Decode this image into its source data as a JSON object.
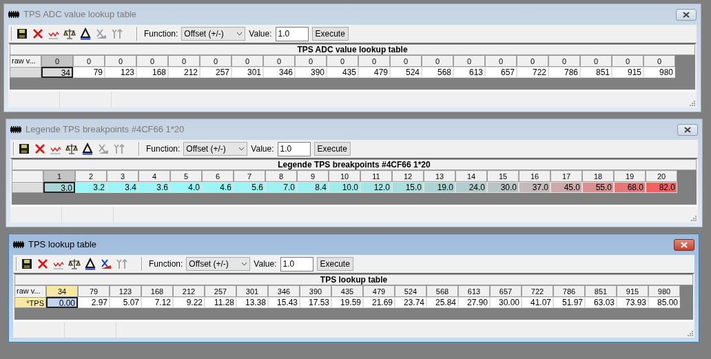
{
  "windows": [
    {
      "title": "TPS ADC value lookup table",
      "active": false,
      "toolbar": {
        "icons": [
          {
            "kind": "save",
            "disabled": false
          },
          {
            "kind": "delete",
            "disabled": false
          },
          {
            "kind": "graph",
            "disabled": false
          },
          {
            "kind": "scale",
            "disabled": false
          },
          {
            "kind": "delta",
            "disabled": false
          },
          {
            "kind": "x-axis",
            "disabled": true
          },
          {
            "kind": "y-axis",
            "disabled": true
          }
        ],
        "function_label": "Function:",
        "function": "Offset (+/-)",
        "value_label": "Value:",
        "value": "1.0",
        "execute": "Execute"
      },
      "table": {
        "title": "TPS ADC value lookup table",
        "corner": "raw v...",
        "columns": [
          {
            "label": "0",
            "selected": true
          },
          {
            "label": "0",
            "selected": false
          },
          {
            "label": "0",
            "selected": false
          },
          {
            "label": "0",
            "selected": false
          },
          {
            "label": "0",
            "selected": false
          },
          {
            "label": "0",
            "selected": false
          },
          {
            "label": "0",
            "selected": false
          },
          {
            "label": "0",
            "selected": false
          },
          {
            "label": "0",
            "selected": false
          },
          {
            "label": "0",
            "selected": false
          },
          {
            "label": "0",
            "selected": false
          },
          {
            "label": "0",
            "selected": false
          },
          {
            "label": "0",
            "selected": false
          },
          {
            "label": "0",
            "selected": false
          },
          {
            "label": "0",
            "selected": false
          },
          {
            "label": "0",
            "selected": false
          },
          {
            "label": "0",
            "selected": false
          },
          {
            "label": "0",
            "selected": false
          },
          {
            "label": "0",
            "selected": false
          },
          {
            "label": "0",
            "selected": false
          }
        ],
        "cells": [
          {
            "value": "34",
            "selected": true
          },
          {
            "value": "79",
            "selected": false
          },
          {
            "value": "123",
            "selected": false
          },
          {
            "value": "168",
            "selected": false
          },
          {
            "value": "212",
            "selected": false
          },
          {
            "value": "257",
            "selected": false
          },
          {
            "value": "301",
            "selected": false
          },
          {
            "value": "346",
            "selected": false
          },
          {
            "value": "390",
            "selected": false
          },
          {
            "value": "435",
            "selected": false
          },
          {
            "value": "479",
            "selected": false
          },
          {
            "value": "524",
            "selected": false
          },
          {
            "value": "568",
            "selected": false
          },
          {
            "value": "613",
            "selected": false
          },
          {
            "value": "657",
            "selected": false
          },
          {
            "value": "722",
            "selected": false
          },
          {
            "value": "786",
            "selected": false
          },
          {
            "value": "851",
            "selected": false
          },
          {
            "value": "915",
            "selected": false
          },
          {
            "value": "980",
            "selected": false
          }
        ]
      }
    },
    {
      "title": "Legende TPS breakpoints #4CF66 1*20",
      "active": false,
      "toolbar": {
        "icons": [
          {
            "kind": "save",
            "disabled": false
          },
          {
            "kind": "delete",
            "disabled": false
          },
          {
            "kind": "graph",
            "disabled": false
          },
          {
            "kind": "scale",
            "disabled": false
          },
          {
            "kind": "delta",
            "disabled": false
          },
          {
            "kind": "x-axis",
            "disabled": true
          },
          {
            "kind": "y-axis",
            "disabled": true
          }
        ],
        "function_label": "Function:",
        "function": "Offset (+/-)",
        "value_label": "Value:",
        "value": "1.0",
        "execute": "Execute"
      },
      "table": {
        "title": "Legende TPS breakpoints #4CF66 1*20",
        "columns": [
          {
            "label": "1",
            "selected": true
          },
          {
            "label": "2",
            "selected": false
          },
          {
            "label": "3",
            "selected": false
          },
          {
            "label": "4",
            "selected": false
          },
          {
            "label": "5",
            "selected": false
          },
          {
            "label": "6",
            "selected": false
          },
          {
            "label": "7",
            "selected": false
          },
          {
            "label": "8",
            "selected": false
          },
          {
            "label": "9",
            "selected": false
          },
          {
            "label": "10",
            "selected": false
          },
          {
            "label": "11",
            "selected": false
          },
          {
            "label": "12",
            "selected": false
          },
          {
            "label": "13",
            "selected": false
          },
          {
            "label": "14",
            "selected": false
          },
          {
            "label": "15",
            "selected": false
          },
          {
            "label": "16",
            "selected": false
          },
          {
            "label": "17",
            "selected": false
          },
          {
            "label": "18",
            "selected": false
          },
          {
            "label": "19",
            "selected": false
          },
          {
            "label": "20",
            "selected": false
          }
        ],
        "cells": [
          {
            "value": "3.0",
            "selected": true,
            "color": "#a8d6d6"
          },
          {
            "value": "3.2",
            "selected": false,
            "color": "#9af6f6"
          },
          {
            "value": "3.4",
            "selected": false,
            "color": "#9af6f6"
          },
          {
            "value": "3.6",
            "selected": false,
            "color": "#9af6f6"
          },
          {
            "value": "4.0",
            "selected": false,
            "color": "#9af6f6"
          },
          {
            "value": "4.6",
            "selected": false,
            "color": "#9af6f6"
          },
          {
            "value": "5.6",
            "selected": false,
            "color": "#9cf4f4"
          },
          {
            "value": "7.0",
            "selected": false,
            "color": "#9cf2f2"
          },
          {
            "value": "8.4",
            "selected": false,
            "color": "#9ef0f0"
          },
          {
            "value": "10.0",
            "selected": false,
            "color": "#a0ecec"
          },
          {
            "value": "12.0",
            "selected": false,
            "color": "#a4e6e6"
          },
          {
            "value": "15.0",
            "selected": false,
            "color": "#a8e0e0"
          },
          {
            "value": "19.0",
            "selected": false,
            "color": "#aad4d4"
          },
          {
            "value": "24.0",
            "selected": false,
            "color": "#b0cccc"
          },
          {
            "value": "30.0",
            "selected": false,
            "color": "#b8c4c4"
          },
          {
            "value": "37.0",
            "selected": false,
            "color": "#c4b8b8"
          },
          {
            "value": "45.0",
            "selected": false,
            "color": "#cca8a8"
          },
          {
            "value": "55.0",
            "selected": false,
            "color": "#d89090"
          },
          {
            "value": "68.0",
            "selected": false,
            "color": "#e47878"
          },
          {
            "value": "82.0",
            "selected": false,
            "color": "#f26262"
          }
        ]
      }
    },
    {
      "title": "TPS lookup table",
      "active": true,
      "toolbar": {
        "icons": [
          {
            "kind": "save",
            "disabled": false
          },
          {
            "kind": "delete",
            "disabled": false
          },
          {
            "kind": "graph",
            "disabled": false
          },
          {
            "kind": "scale",
            "disabled": false
          },
          {
            "kind": "delta",
            "disabled": false
          },
          {
            "kind": "x-axis",
            "disabled": false
          },
          {
            "kind": "y-axis",
            "disabled": true
          }
        ],
        "function_label": "Function:",
        "function": "Offset (+/-)",
        "value_label": "Value:",
        "value": "1.0",
        "execute": "Execute"
      },
      "table": {
        "title": "TPS lookup table",
        "corner": "raw v...",
        "row_header": "°TPS",
        "row_selected": true,
        "columns": [
          {
            "label": "34",
            "selected": true
          },
          {
            "label": "79",
            "selected": false
          },
          {
            "label": "123",
            "selected": false
          },
          {
            "label": "168",
            "selected": false
          },
          {
            "label": "212",
            "selected": false
          },
          {
            "label": "257",
            "selected": false
          },
          {
            "label": "301",
            "selected": false
          },
          {
            "label": "346",
            "selected": false
          },
          {
            "label": "390",
            "selected": false
          },
          {
            "label": "435",
            "selected": false
          },
          {
            "label": "479",
            "selected": false
          },
          {
            "label": "524",
            "selected": false
          },
          {
            "label": "568",
            "selected": false
          },
          {
            "label": "613",
            "selected": false
          },
          {
            "label": "657",
            "selected": false
          },
          {
            "label": "722",
            "selected": false
          },
          {
            "label": "786",
            "selected": false
          },
          {
            "label": "851",
            "selected": false
          },
          {
            "label": "915",
            "selected": false
          },
          {
            "label": "980",
            "selected": false
          }
        ],
        "cells": [
          {
            "value": "0.00",
            "selected": true
          },
          {
            "value": "2.97",
            "selected": false
          },
          {
            "value": "5.07",
            "selected": false
          },
          {
            "value": "7.12",
            "selected": false
          },
          {
            "value": "9.22",
            "selected": false
          },
          {
            "value": "11.28",
            "selected": false
          },
          {
            "value": "13.38",
            "selected": false
          },
          {
            "value": "15.43",
            "selected": false
          },
          {
            "value": "17.53",
            "selected": false
          },
          {
            "value": "19.59",
            "selected": false
          },
          {
            "value": "21.69",
            "selected": false
          },
          {
            "value": "23.74",
            "selected": false
          },
          {
            "value": "25.84",
            "selected": false
          },
          {
            "value": "27.90",
            "selected": false
          },
          {
            "value": "30.00",
            "selected": false
          },
          {
            "value": "41.07",
            "selected": false
          },
          {
            "value": "51.97",
            "selected": false
          },
          {
            "value": "63.03",
            "selected": false
          },
          {
            "value": "73.93",
            "selected": false
          },
          {
            "value": "85.00",
            "selected": false
          }
        ]
      }
    }
  ]
}
